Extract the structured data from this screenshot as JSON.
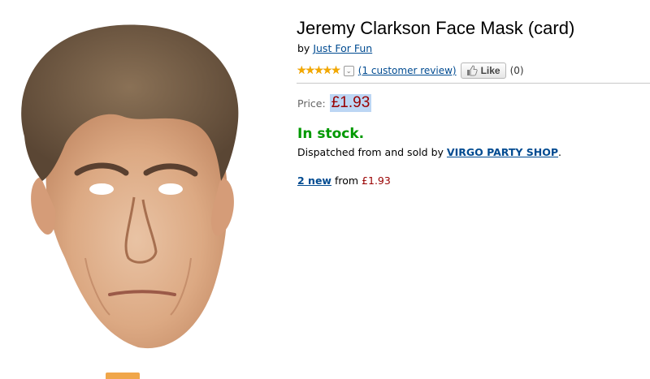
{
  "product": {
    "title": "Jeremy Clarkson Face Mask (card)",
    "by_prefix": "by",
    "brand": "Just For Fun",
    "rating": {
      "stars_display": "★★★★★",
      "stars_value": 5,
      "stars_max": 5,
      "dropdown_glyph": "⌄",
      "review_link": "(1 customer review)"
    },
    "like": {
      "label": "Like",
      "count": "(0)"
    },
    "price": {
      "label": "Price:",
      "value": "£1.93"
    },
    "availability": {
      "status": "In stock.",
      "dispatch_text": "Dispatched from and sold by",
      "seller": "VIRGO PARTY SHOP",
      "dispatch_end": "."
    },
    "offers": {
      "new_link": "2 new",
      "from_text": "from",
      "from_price": "£1.93"
    }
  },
  "colors": {
    "link": "#004b91",
    "price": "#990000",
    "in_stock": "#009900",
    "star": "#f3a900",
    "price_highlight": "#bcd6f4"
  },
  "icons": {
    "stars": "star-rating-icon",
    "dropdown": "chevron-down-icon",
    "like": "thumbs-up-icon"
  }
}
